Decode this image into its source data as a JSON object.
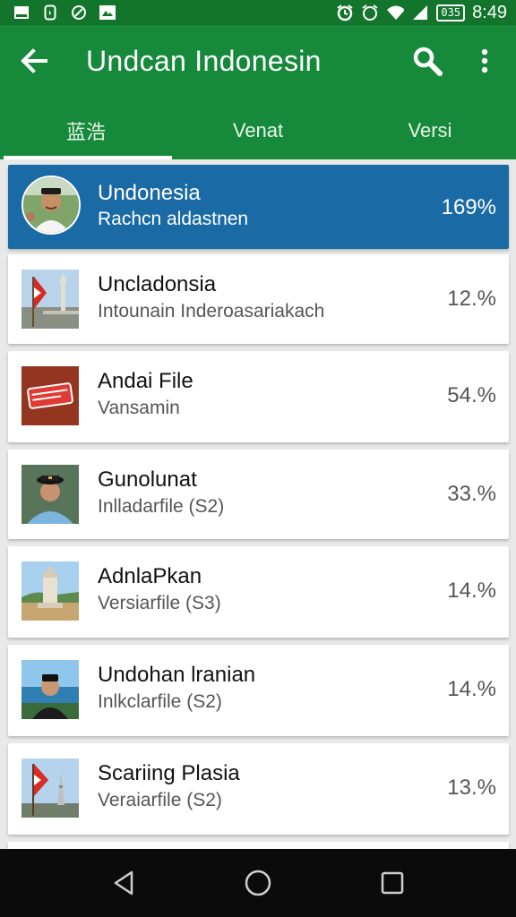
{
  "status_bar": {
    "left_icons": [
      "image-icon",
      "sim-icon",
      "sync-icon",
      "photo-icon"
    ],
    "right_icons": [
      "alarm-icon",
      "alarm-icon",
      "wifi-icon",
      "signal-icon"
    ],
    "battery": "035",
    "time": "8:49"
  },
  "app_bar": {
    "title": "Undcan Indonesin",
    "tabs": [
      {
        "label": "蓝浩"
      },
      {
        "label": "Venat"
      },
      {
        "label": "Versi"
      }
    ],
    "active_tab": 0
  },
  "list": {
    "items": [
      {
        "title": "Undonesia",
        "subtitle": "Rachcn aldastnen",
        "percent": "169%",
        "thumb": "portrait-man-icon",
        "selected": true
      },
      {
        "title": "Uncladonsia",
        "subtitle": "Intounain Inderoasariakach",
        "percent": "12.%",
        "thumb": "flag-monument-icon"
      },
      {
        "title": "Andai File",
        "subtitle": "Vansamin",
        "percent": "54.%",
        "thumb": "sign-icon"
      },
      {
        "title": "Gunolunat",
        "subtitle": "Inlladarfile (S2)",
        "percent": "33.%",
        "thumb": "officer-icon"
      },
      {
        "title": "AdnlaPkan",
        "subtitle": "Versiarfile (S3)",
        "percent": "14.%",
        "thumb": "temple-icon"
      },
      {
        "title": "Undohan lranian",
        "subtitle": "Inlkclarfile (S2)",
        "percent": "14.%",
        "thumb": "person-lake-icon"
      },
      {
        "title": "Scariing Plasia",
        "subtitle": "Veraiarfile (S2)",
        "percent": "13.%",
        "thumb": "flag-tower-icon"
      }
    ]
  },
  "nav_bar": {
    "buttons": [
      "back-triangle-icon",
      "home-circle-icon",
      "recents-square-icon"
    ]
  },
  "colors": {
    "status_bar": "#13752c",
    "app_bar": "#16893a",
    "selected_row": "#1a6aa6"
  }
}
